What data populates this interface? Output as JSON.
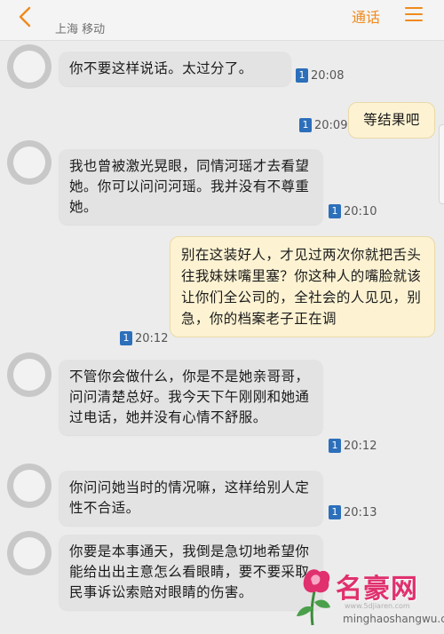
{
  "header": {
    "carrier": "上海 移动",
    "call_label": "通话",
    "back_icon": "chevron-left-icon",
    "menu_icon": "menu-icon",
    "accent_color": "#f08a1c"
  },
  "sim_label": "1",
  "messages": [
    {
      "direction": "in",
      "text": "你不要这样说话。太过分了。",
      "time": "20:08"
    },
    {
      "direction": "out",
      "text": "等结果吧",
      "time": "20:09"
    },
    {
      "direction": "in",
      "text": "我也曾被激光晃眼，同情河瑶才去看望她。你可以问问河瑶。我并没有不尊重她。",
      "time": "20:10"
    },
    {
      "direction": "out",
      "text": "别在这装好人，才见过两次你就把舌头往我妹妹嘴里塞？你这种人的嘴脸就该让你们全公司的，全社会的人见见，别急，你的档案老子正在调",
      "time": "20:12"
    },
    {
      "direction": "in",
      "text": "不管你会做什么，你是不是她亲哥哥，问问清楚总好。我今天下午刚刚和她通过电话，她并没有心情不舒服。",
      "time": "20:12"
    },
    {
      "direction": "in",
      "text": "你问问她当时的情况嘛，这样给别人定性不合适。",
      "time": "20:13"
    },
    {
      "direction": "in",
      "text": "你要是本事通天，我倒是急切地希望你能给出出主意怎么看眼睛，要不要采取民事诉讼索赔对眼睛的伤害。",
      "time": ""
    }
  ],
  "watermark": {
    "title": "名豪网",
    "small": "www.5djiaren.com",
    "url": "minghaoshangwu.com"
  }
}
